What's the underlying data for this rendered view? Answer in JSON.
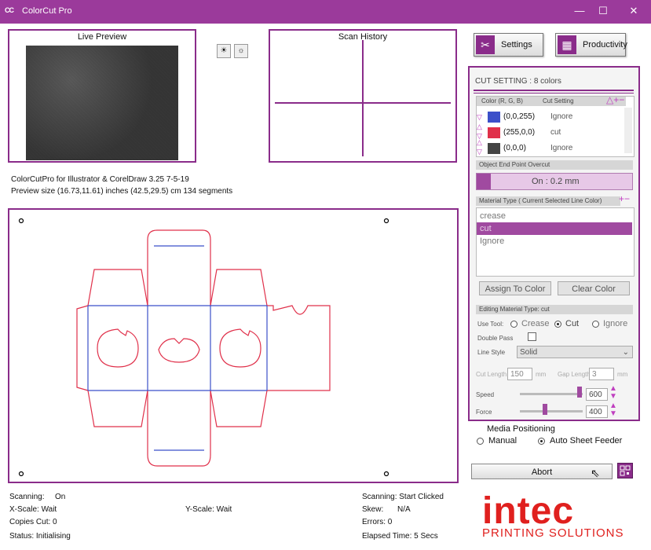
{
  "window": {
    "title": "ColorCut Pro",
    "icon_text": "CC",
    "minimize": "—",
    "maximize": "☐",
    "close": "✕"
  },
  "live_preview": {
    "title": "Live Preview"
  },
  "scan_history": {
    "title": "Scan History"
  },
  "info": {
    "line1": "ColorCutPro for Illustrator & CorelDraw 3.25 7-5-19",
    "line2": "Preview size (16.73,11.61) inches  (42.5,29.5) cm   134 segments"
  },
  "buttons": {
    "settings": "Settings",
    "productivity": "Productivity",
    "abort": "Abort"
  },
  "cut_setting": {
    "title": "CUT SETTING : 8 colors",
    "col_color": "Color (R, G, B)",
    "col_setting": "Cut Setting",
    "rows": [
      {
        "rgb": "(0,0,255)",
        "setting": "Ignore",
        "color": "#3b4fc9"
      },
      {
        "rgb": "(255,0,0)",
        "setting": "cut",
        "color": "#e0304a"
      },
      {
        "rgb": "(0,0,0)",
        "setting": "Ignore",
        "color": "#444444"
      }
    ],
    "overcut_label": "Object End Point Overcut",
    "overcut_value": "On : 0.2 mm",
    "material_label": "Material Type ( Current Selected Line Color)",
    "materials": [
      "crease",
      "cut",
      "Ignore"
    ],
    "selected_material": "cut",
    "assign_button": "Assign To Color",
    "clear_button": "Clear Color",
    "editing_label": "Editing Material Type: cut",
    "use_tool_label": "Use Tool:",
    "tool_options": [
      "Crease",
      "Cut",
      "Ignore"
    ],
    "selected_tool": "Cut",
    "double_pass_label": "Double Pass",
    "line_style_label": "Line Style",
    "line_style_value": "Solid",
    "cut_length_label": "Cut Length",
    "cut_length_value": "150",
    "cut_length_unit": "mm",
    "gap_length_label": "Gap Length",
    "gap_length_value": "3",
    "gap_length_unit": "mm",
    "speed_label": "Speed",
    "speed_value": "600",
    "speed_level": 0.95,
    "force_label": "Force",
    "force_value": "400",
    "force_level": 0.4
  },
  "media": {
    "title": "Media Positioning",
    "options": [
      "Manual",
      "Auto Sheet Feeder"
    ],
    "selected": "Auto Sheet Feeder"
  },
  "status": {
    "scanning": "Scanning:",
    "scanning_value": "On",
    "xscale": "X-Scale: Wait",
    "yscale": "Y-Scale: Wait",
    "copies": "Copies Cut:  0",
    "status": "Status: Initialising",
    "scanning_state": "Scanning: Start Clicked",
    "skew": "Skew:",
    "skew_value": "N/A",
    "errors": "Errors: 0",
    "elapsed": "Elapsed Time:  5 Secs"
  },
  "logo": {
    "name": "intec",
    "tagline": "PRINTING SOLUTIONS"
  },
  "colors": {
    "accent": "#8a2c8a",
    "title_bar": "#9b3a9b",
    "red_line": "#e0304a",
    "blue_line": "#3b4fc9",
    "brand": "#e0201e"
  }
}
